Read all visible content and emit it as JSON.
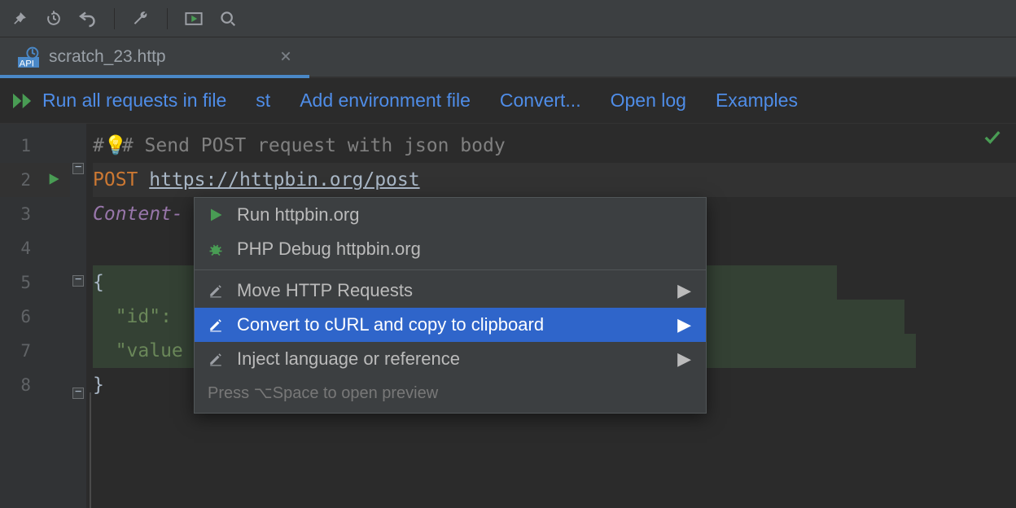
{
  "tab": {
    "label": "scratch_23.http"
  },
  "actions": {
    "run_all": "Run all requests in file",
    "st": "st",
    "add_env": "Add environment file",
    "convert": "Convert...",
    "open_log": "Open log",
    "examples": "Examples"
  },
  "code": {
    "l1_comment": "# Send POST request with json body",
    "l1_prefix": "#",
    "l2_method": "POST",
    "l2_url": "https://httpbin.org/post",
    "l3_header": "Content-",
    "l5_open": "{",
    "l6": "  \"id\":",
    "l7": "  \"value",
    "l8_close": "}"
  },
  "gutter": [
    "1",
    "2",
    "3",
    "4",
    "5",
    "6",
    "7",
    "8"
  ],
  "menu": {
    "run": "Run httpbin.org",
    "php": "PHP Debug httpbin.org",
    "move": "Move HTTP Requests",
    "convert": "Convert to cURL and copy to clipboard",
    "inject": "Inject language or reference",
    "hint": "Press ⌥Space to open preview"
  }
}
